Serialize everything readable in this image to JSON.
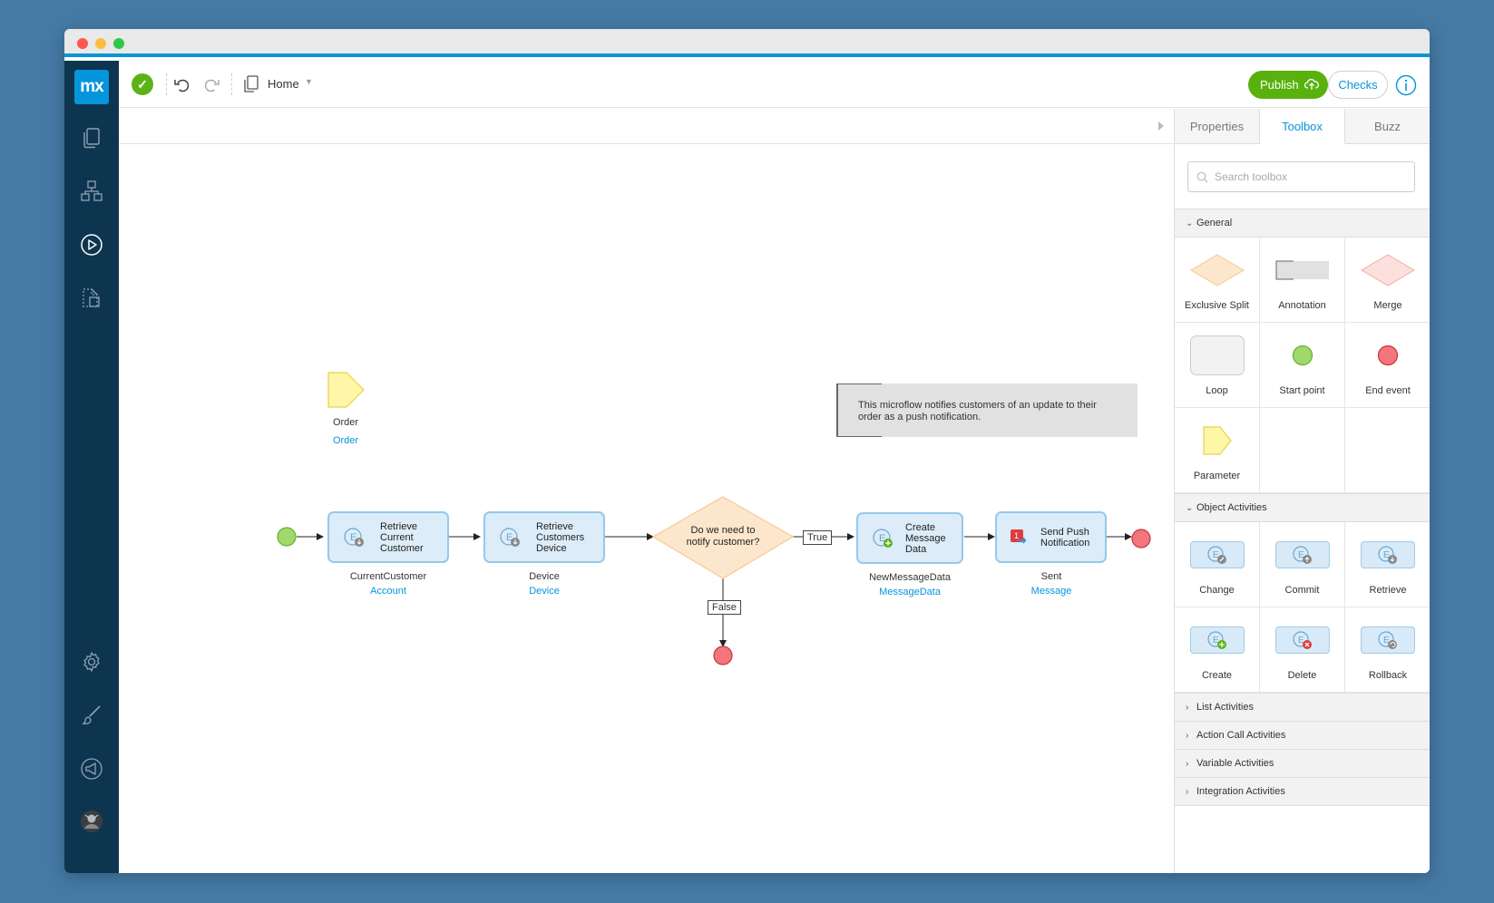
{
  "colors": {
    "accent": "#0595db",
    "publish_green": "#58b10d",
    "nav_dark": "#0e3550",
    "activity_fill": "#dcecf8",
    "activity_border": "#96c8ec",
    "start_green": "#9fd96b",
    "end_red": "#f2767b"
  },
  "app": {
    "logo": "mx"
  },
  "leftnav": {
    "icons": [
      "pages-icon",
      "domain-model-icon",
      "play-icon",
      "documents-icon",
      "settings-icon",
      "brush-icon",
      "megaphone-icon",
      "avatar"
    ]
  },
  "toolbar": {
    "breadcrumb": "Home",
    "publish_label": "Publish",
    "checks_label": "Checks"
  },
  "panel": {
    "tabs": [
      "Properties",
      "Toolbox",
      "Buzz"
    ],
    "active_tab": "Toolbox",
    "search_placeholder": "Search toolbox",
    "sections": {
      "general": {
        "title": "General",
        "items": [
          "Exclusive Split",
          "Annotation",
          "Merge",
          "Loop",
          "Start point",
          "End event",
          "Parameter"
        ]
      },
      "object": {
        "title": "Object Activities",
        "items": [
          "Change",
          "Commit",
          "Retrieve",
          "Create",
          "Delete",
          "Rollback"
        ]
      },
      "collapsed": [
        "List Activities",
        "Action Call Activities",
        "Variable Activities",
        "Integration Activities"
      ]
    }
  },
  "diagram": {
    "parameter": {
      "name": "Order",
      "type": "Order"
    },
    "annotation": "This microflow notifies customers of an update to their order as a push notification.",
    "activities": [
      {
        "label_lines": [
          "Retrieve",
          "Current",
          "Customer"
        ],
        "var": "CurrentCustomer",
        "type": "Account"
      },
      {
        "label_lines": [
          "Retrieve",
          "Customers",
          "Device"
        ],
        "var": "Device",
        "type": "Device"
      },
      {
        "label_lines": [
          "Create",
          "Message",
          "Data"
        ],
        "var": "NewMessageData",
        "type": "MessageData"
      },
      {
        "label_lines": [
          "Send Push",
          "Notification"
        ],
        "var": "Sent",
        "type": "Message"
      }
    ],
    "decision": {
      "lines": [
        "Do we need to",
        "notify customer?"
      ]
    },
    "true_label": "True",
    "false_label": "False"
  }
}
